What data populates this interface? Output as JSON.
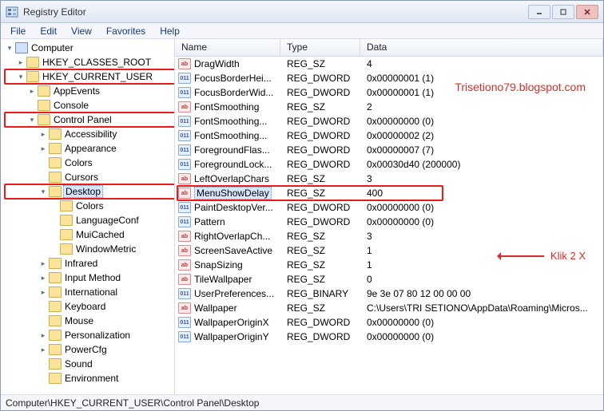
{
  "app": {
    "title": "Registry Editor"
  },
  "menu": {
    "file": "File",
    "edit": "Edit",
    "view": "View",
    "favorites": "Favorites",
    "help": "Help"
  },
  "watermark": "Trisetiono79.blogspot.com",
  "annotation": "Klik 2 X",
  "statusbar": "Computer\\HKEY_CURRENT_USER\\Control Panel\\Desktop",
  "columns": {
    "name": "Name",
    "type": "Type",
    "data": "Data"
  },
  "tree": {
    "root": "Computer",
    "hives": [
      {
        "label": "HKEY_CLASSES_ROOT",
        "expand": "closed"
      },
      {
        "label": "HKEY_CURRENT_USER",
        "expand": "open",
        "highlight": true,
        "children": [
          {
            "label": "AppEvents",
            "expand": "closed"
          },
          {
            "label": "Console",
            "expand": "none"
          },
          {
            "label": "Control Panel",
            "expand": "open",
            "highlight": true,
            "children": [
              {
                "label": "Accessibility",
                "expand": "closed"
              },
              {
                "label": "Appearance",
                "expand": "closed"
              },
              {
                "label": "Colors",
                "expand": "none"
              },
              {
                "label": "Cursors",
                "expand": "none"
              },
              {
                "label": "Desktop",
                "expand": "open",
                "highlight": true,
                "selected": true,
                "children": [
                  {
                    "label": "Colors",
                    "expand": "none"
                  },
                  {
                    "label": "LanguageConf",
                    "expand": "none"
                  },
                  {
                    "label": "MuiCached",
                    "expand": "none"
                  },
                  {
                    "label": "WindowMetric",
                    "expand": "none"
                  }
                ]
              },
              {
                "label": "Infrared",
                "expand": "closed"
              },
              {
                "label": "Input Method",
                "expand": "closed"
              },
              {
                "label": "International",
                "expand": "closed"
              },
              {
                "label": "Keyboard",
                "expand": "none"
              },
              {
                "label": "Mouse",
                "expand": "none"
              },
              {
                "label": "Personalization",
                "expand": "closed"
              },
              {
                "label": "PowerCfg",
                "expand": "closed"
              },
              {
                "label": "Sound",
                "expand": "none"
              },
              {
                "label": "Environment",
                "expand": "none"
              }
            ]
          }
        ]
      }
    ]
  },
  "values": [
    {
      "name": "DragWidth",
      "type": "REG_SZ",
      "data": "4",
      "icon": "sz"
    },
    {
      "name": "FocusBorderHei...",
      "type": "REG_DWORD",
      "data": "0x00000001 (1)",
      "icon": "bin"
    },
    {
      "name": "FocusBorderWid...",
      "type": "REG_DWORD",
      "data": "0x00000001 (1)",
      "icon": "bin"
    },
    {
      "name": "FontSmoothing",
      "type": "REG_SZ",
      "data": "2",
      "icon": "sz"
    },
    {
      "name": "FontSmoothing...",
      "type": "REG_DWORD",
      "data": "0x00000000 (0)",
      "icon": "bin"
    },
    {
      "name": "FontSmoothing...",
      "type": "REG_DWORD",
      "data": "0x00000002 (2)",
      "icon": "bin"
    },
    {
      "name": "ForegroundFlas...",
      "type": "REG_DWORD",
      "data": "0x00000007 (7)",
      "icon": "bin"
    },
    {
      "name": "ForegroundLock...",
      "type": "REG_DWORD",
      "data": "0x00030d40 (200000)",
      "icon": "bin"
    },
    {
      "name": "LeftOverlapChars",
      "type": "REG_SZ",
      "data": "3",
      "icon": "sz"
    },
    {
      "name": "MenuShowDelay",
      "type": "REG_SZ",
      "data": "400",
      "icon": "sz",
      "selected": true,
      "highlight": true
    },
    {
      "name": "PaintDesktopVer...",
      "type": "REG_DWORD",
      "data": "0x00000000 (0)",
      "icon": "bin"
    },
    {
      "name": "Pattern",
      "type": "REG_DWORD",
      "data": "0x00000000 (0)",
      "icon": "bin"
    },
    {
      "name": "RightOverlapCh...",
      "type": "REG_SZ",
      "data": "3",
      "icon": "sz"
    },
    {
      "name": "ScreenSaveActive",
      "type": "REG_SZ",
      "data": "1",
      "icon": "sz"
    },
    {
      "name": "SnapSizing",
      "type": "REG_SZ",
      "data": "1",
      "icon": "sz"
    },
    {
      "name": "TileWallpaper",
      "type": "REG_SZ",
      "data": "0",
      "icon": "sz"
    },
    {
      "name": "UserPreferences...",
      "type": "REG_BINARY",
      "data": "9e 3e 07 80 12 00 00 00",
      "icon": "bin"
    },
    {
      "name": "Wallpaper",
      "type": "REG_SZ",
      "data": "C:\\Users\\TRI SETIONO\\AppData\\Roaming\\Micros...",
      "icon": "sz"
    },
    {
      "name": "WallpaperOriginX",
      "type": "REG_DWORD",
      "data": "0x00000000 (0)",
      "icon": "bin"
    },
    {
      "name": "WallpaperOriginY",
      "type": "REG_DWORD",
      "data": "0x00000000 (0)",
      "icon": "bin"
    }
  ]
}
